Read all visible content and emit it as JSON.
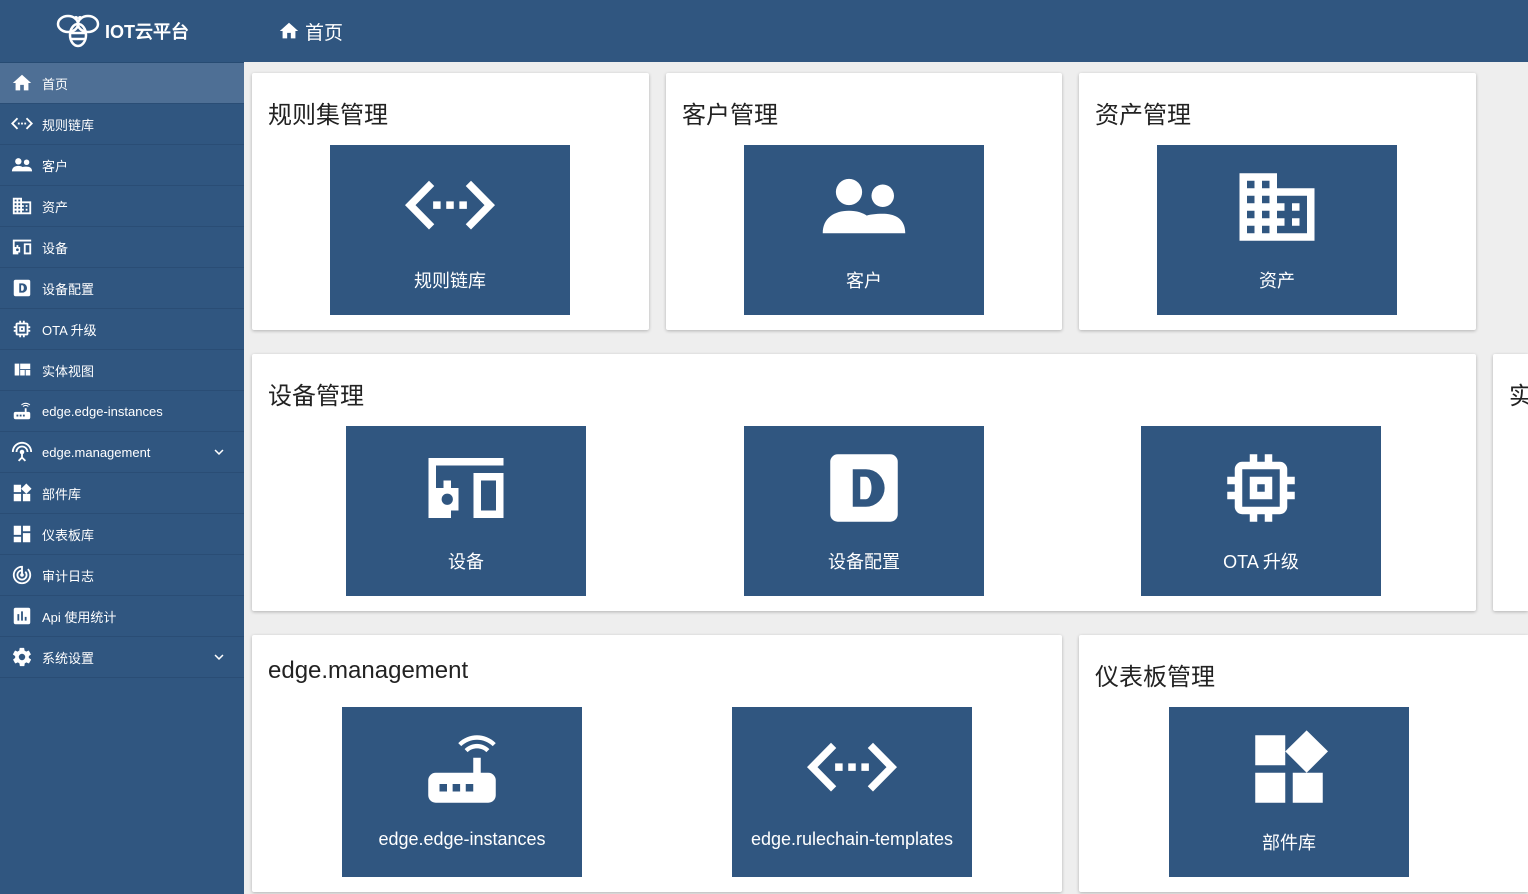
{
  "logo": {
    "text": "IOT云平台"
  },
  "topbar": {
    "breadcrumb": "首页"
  },
  "sidebar": {
    "items": [
      {
        "label": "首页"
      },
      {
        "label": "规则链库"
      },
      {
        "label": "客户"
      },
      {
        "label": "资产"
      },
      {
        "label": "设备"
      },
      {
        "label": "设备配置"
      },
      {
        "label": "OTA 升级"
      },
      {
        "label": "实体视图"
      },
      {
        "label": "edge.edge-instances"
      },
      {
        "label": "edge.management"
      },
      {
        "label": "部件库"
      },
      {
        "label": "仪表板库"
      },
      {
        "label": "审计日志"
      },
      {
        "label": "Api 使用统计"
      },
      {
        "label": "系统设置"
      }
    ]
  },
  "cards": {
    "rulechains": {
      "title": "规则集管理",
      "tiles": [
        {
          "label": "规则链库"
        }
      ]
    },
    "customers": {
      "title": "客户管理",
      "tiles": [
        {
          "label": "客户"
        }
      ]
    },
    "assets": {
      "title": "资产管理",
      "tiles": [
        {
          "label": "资产"
        }
      ]
    },
    "devices": {
      "title": "设备管理",
      "tiles": [
        {
          "label": "设备"
        },
        {
          "label": "设备配置"
        },
        {
          "label": "OTA 升级"
        }
      ]
    },
    "entity_partial": {
      "title": "实"
    },
    "edge": {
      "title": "edge.management",
      "tiles": [
        {
          "label": "edge.edge-instances"
        },
        {
          "label": "edge.rulechain-templates"
        }
      ]
    },
    "dashboards": {
      "title": "仪表板管理",
      "tiles": [
        {
          "label": "部件库"
        }
      ]
    }
  }
}
